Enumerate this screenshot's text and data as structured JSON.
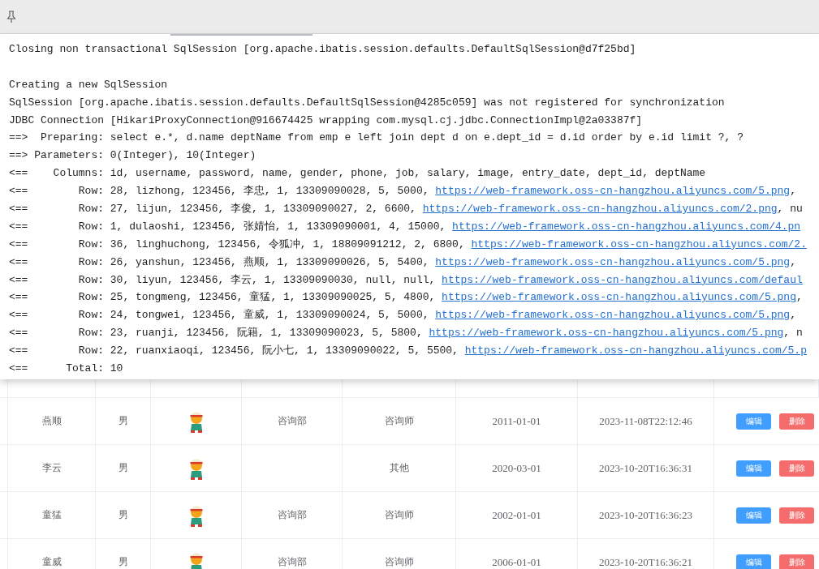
{
  "console": {
    "blocks": [
      {
        "lines": [
          {
            "text": "Closing non transactional SqlSession [org.apache.ibatis.session.defaults.DefaultSqlSession@d7f25bd]"
          }
        ]
      },
      {
        "lines": [
          {
            "text": "Creating a new SqlSession"
          },
          {
            "text": "SqlSession [org.apache.ibatis.session.defaults.DefaultSqlSession@4285c059] was not registered for synchronization"
          },
          {
            "text": "JDBC Connection [HikariProxyConnection@916674425 wrapping com.mysql.cj.jdbc.ConnectionImpl@2a03387f]"
          },
          {
            "text": "==>  Preparing: select e.*, d.name deptName from emp e left join dept d on e.dept_id = d.id order by e.id limit ?, ?"
          },
          {
            "text": "==> Parameters: 0(Integer), 10(Integer)"
          },
          {
            "text": "<==    Columns: id, username, password, name, gender, phone, job, salary, image, entry_date, dept_id, deptName"
          },
          {
            "text": "<==        Row: 28, lizhong, 123456, 李忠, 1, 13309090028, 5, 5000, ",
            "link": "https://web-framework.oss-cn-hangzhou.aliyuncs.com/5.png",
            "after": ","
          },
          {
            "text": "<==        Row: 27, lijun, 123456, 李俊, 1, 13309090027, 2, 6600, ",
            "link": "https://web-framework.oss-cn-hangzhou.aliyuncs.com/2.png",
            "after": ", nu"
          },
          {
            "text": "<==        Row: 1, dulaoshi, 123456, 张婧怡, 1, 13309090001, 4, 15000, ",
            "link": "https://web-framework.oss-cn-hangzhou.aliyuncs.com/4.pn"
          },
          {
            "text": "<==        Row: 36, linghuchong, 123456, 令狐冲, 1, 18809091212, 2, 6800, ",
            "link": "https://web-framework.oss-cn-hangzhou.aliyuncs.com/2."
          },
          {
            "text": "<==        Row: 26, yanshun, 123456, 燕顺, 1, 13309090026, 5, 5400, ",
            "link": "https://web-framework.oss-cn-hangzhou.aliyuncs.com/5.png",
            "after": ","
          },
          {
            "text": "<==        Row: 30, liyun, 123456, 李云, 1, 13309090030, null, null, ",
            "link": "https://web-framework.oss-cn-hangzhou.aliyuncs.com/defaul"
          },
          {
            "text": "<==        Row: 25, tongmeng, 123456, 童猛, 1, 13309090025, 5, 4800, ",
            "link": "https://web-framework.oss-cn-hangzhou.aliyuncs.com/5.png",
            "after": ","
          },
          {
            "text": "<==        Row: 24, tongwei, 123456, 童威, 1, 13309090024, 5, 5000, ",
            "link": "https://web-framework.oss-cn-hangzhou.aliyuncs.com/5.png",
            "after": ","
          },
          {
            "text": "<==        Row: 23, ruanji, 123456, 阮籍, 1, 13309090023, 5, 5800, ",
            "link": "https://web-framework.oss-cn-hangzhou.aliyuncs.com/5.png",
            "after": ", n"
          },
          {
            "text": "<==        Row: 22, ruanxiaoqi, 123456, 阮小七, 1, 13309090022, 5, 5500, ",
            "link": "https://web-framework.oss-cn-hangzhou.aliyuncs.com/5.p"
          },
          {
            "text": "<==      Total: 10"
          }
        ]
      }
    ]
  },
  "table": {
    "rows": [
      {
        "name": "燕顺",
        "gender": "男",
        "dept": "咨询部",
        "job": "咨询师",
        "entry_date": "2011-01-01",
        "update_time": "2023-11-08T22:12:46",
        "edit": "编辑",
        "delete": "删除"
      },
      {
        "name": "李云",
        "gender": "男",
        "job": "其他",
        "entry_date": "2020-03-01",
        "update_time": "2023-10-20T16:36:31",
        "edit": "编辑",
        "delete": "删除"
      },
      {
        "name": "童猛",
        "gender": "男",
        "dept": "咨询部",
        "job": "咨询师",
        "entry_date": "2002-01-01",
        "update_time": "2023-10-20T16:36:23",
        "edit": "编辑",
        "delete": "删除"
      },
      {
        "name": "童威",
        "gender": "男",
        "dept": "咨询部",
        "job": "咨询师",
        "entry_date": "2006-01-01",
        "update_time": "2023-10-20T16:36:21",
        "edit": "编辑",
        "delete": "删除"
      }
    ]
  }
}
